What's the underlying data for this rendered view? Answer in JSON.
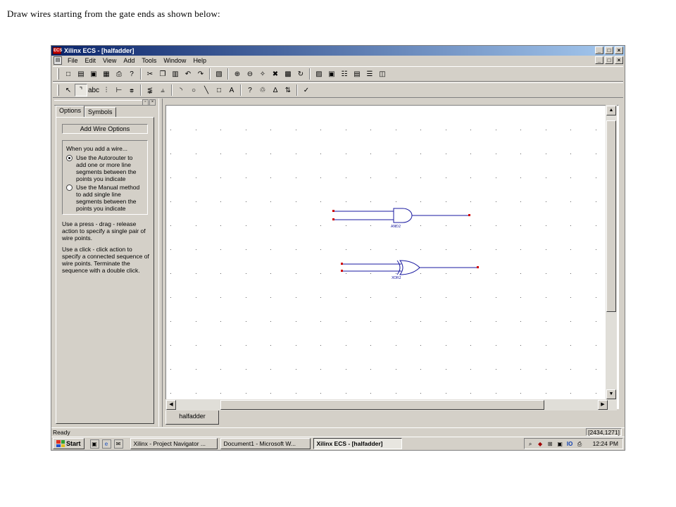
{
  "caption": "Draw wires starting from the gate ends as shown below:",
  "window": {
    "title": "Xilinx ECS - [halfadder]",
    "app_icon": "ecs-app-icon",
    "controls": [
      "_",
      "□",
      "×"
    ]
  },
  "menu": {
    "items": [
      "File",
      "Edit",
      "View",
      "Add",
      "Tools",
      "Window",
      "Help"
    ]
  },
  "toolbar1": {
    "buttons": [
      {
        "name": "new-icon",
        "glyph": "□"
      },
      {
        "name": "open-icon",
        "glyph": "▤"
      },
      {
        "name": "save-icon",
        "glyph": "▣"
      },
      {
        "name": "save-all-icon",
        "glyph": "▦"
      },
      {
        "name": "print-icon",
        "glyph": "⎙"
      },
      {
        "name": "help-icon",
        "glyph": "?"
      },
      {
        "sep": true
      },
      {
        "name": "cut-icon",
        "glyph": "✂"
      },
      {
        "name": "copy-icon",
        "glyph": "❐"
      },
      {
        "name": "paste-icon",
        "glyph": "▥"
      },
      {
        "name": "undo-icon",
        "glyph": "↶"
      },
      {
        "name": "redo-icon",
        "glyph": "↷"
      },
      {
        "sep": true
      },
      {
        "name": "find-icon",
        "glyph": "▧"
      },
      {
        "sep": true
      },
      {
        "name": "zoom-in-icon",
        "glyph": "⊕"
      },
      {
        "name": "zoom-out-icon",
        "glyph": "⊖"
      },
      {
        "name": "zoom-full-icon",
        "glyph": "✧"
      },
      {
        "name": "zoom-fit-icon",
        "glyph": "✖"
      },
      {
        "name": "zoom-area-icon",
        "glyph": "▩"
      },
      {
        "name": "refresh-icon",
        "glyph": "↻"
      },
      {
        "sep": true
      },
      {
        "name": "cascade-icon",
        "glyph": "▨"
      },
      {
        "name": "tile-icon",
        "glyph": "▣"
      },
      {
        "name": "hierarchy-icon",
        "glyph": "☷"
      },
      {
        "name": "window-icon",
        "glyph": "▤"
      },
      {
        "name": "split-h-icon",
        "glyph": "☰"
      },
      {
        "name": "split-v-icon",
        "glyph": "◫"
      }
    ]
  },
  "toolbar2": {
    "buttons": [
      {
        "name": "select-icon",
        "glyph": "↖"
      },
      {
        "name": "add-wire-icon",
        "glyph": "⌝",
        "active": true
      },
      {
        "name": "net-name-icon",
        "glyph": "abc"
      },
      {
        "name": "rename-icon",
        "glyph": "⫶"
      },
      {
        "name": "bus-tap-icon",
        "glyph": "⊢"
      },
      {
        "name": "io-marker-icon",
        "glyph": "⩷"
      },
      {
        "sep": true
      },
      {
        "name": "symbol-icon",
        "glyph": "⪉"
      },
      {
        "name": "instance-icon",
        "glyph": "⫨"
      },
      {
        "sep": true
      },
      {
        "name": "arc-icon",
        "glyph": "◝"
      },
      {
        "name": "circle-icon",
        "glyph": "○"
      },
      {
        "name": "line-icon",
        "glyph": "╲"
      },
      {
        "name": "rectangle-icon",
        "glyph": "□"
      },
      {
        "name": "text-icon",
        "glyph": "A"
      },
      {
        "sep": true
      },
      {
        "name": "query-icon",
        "glyph": "?"
      },
      {
        "name": "lasso-icon",
        "glyph": "♲"
      },
      {
        "name": "mirror-icon",
        "glyph": "∆"
      },
      {
        "name": "rotate-icon",
        "glyph": "⇅"
      },
      {
        "sep": true
      },
      {
        "name": "check-icon",
        "glyph": "✓"
      }
    ]
  },
  "panel": {
    "tabs": [
      "Options",
      "Symbols"
    ],
    "add_wire_options": "Add Wire Options",
    "group_title": "When you add a wire...",
    "radio1": "Use the Autorouter to add one or more line segments between the points you indicate",
    "radio2": "Use the Manual method to add single line segments between the points you indicate",
    "para1": "Use a press - drag - release action to specify a single pair of wire points.",
    "para2": "Use a click - click action to specify a connected sequence of wire points.  Terminate the sequence with a double click."
  },
  "schematic": {
    "gate1_label": "AND2",
    "gate2_label": "XOR2",
    "wire_color": "#1a1aa0",
    "pin_color": "#d00000"
  },
  "doc_tab": "halfadder",
  "status": {
    "text": "Ready",
    "coords": "[2434,1271]"
  },
  "taskbar": {
    "start": "Start",
    "quicklaunch": [
      "desktop-icon",
      "ie-icon",
      "outlook-icon"
    ],
    "tasks": [
      {
        "label": "Xilinx - Project Navigator ...",
        "active": false
      },
      {
        "label": "Document1 - Microsoft W...",
        "active": false
      },
      {
        "label": "Xilinx ECS - [halfadder]",
        "active": true
      }
    ],
    "clock": "12:24 PM"
  }
}
